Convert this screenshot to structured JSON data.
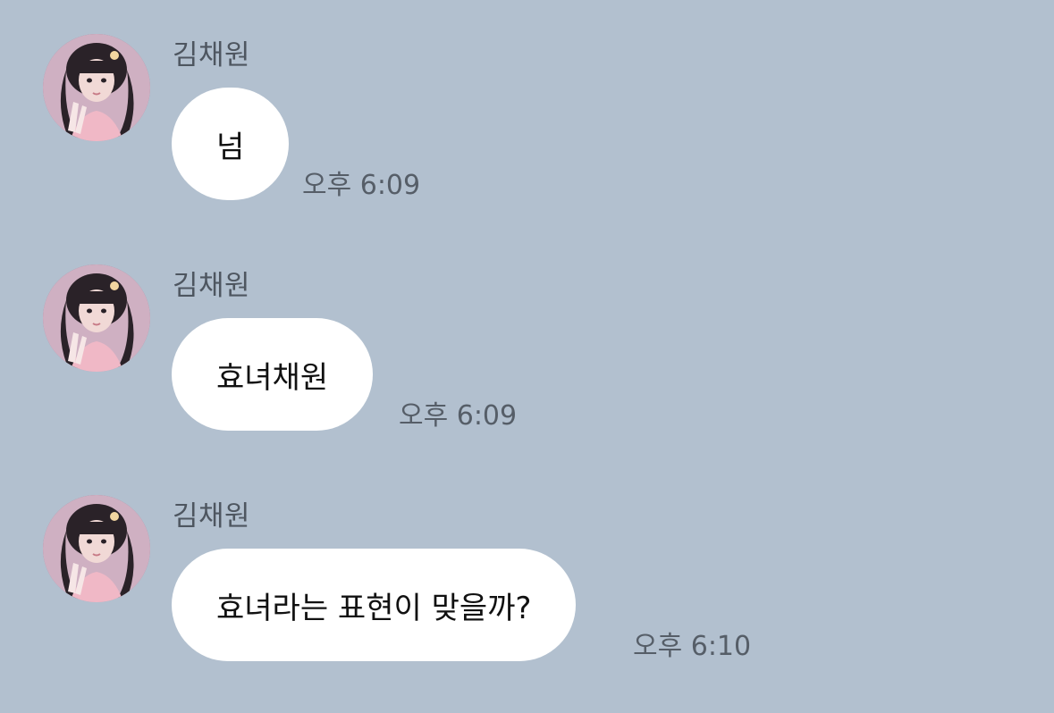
{
  "colors": {
    "background": "#b2c0cf",
    "bubble": "#ffffff",
    "name_text": "#4e5660",
    "time_text": "#565e68"
  },
  "messages": [
    {
      "sender": "김채원",
      "avatar_icon": "profile-photo",
      "text": "넘",
      "time": "오후 6:09"
    },
    {
      "sender": "김채원",
      "avatar_icon": "profile-photo",
      "text": "효녀채원",
      "time": "오후 6:09"
    },
    {
      "sender": "김채원",
      "avatar_icon": "profile-photo",
      "text": "효녀라는 표현이 맞을까?",
      "time": "오후 6:10"
    }
  ]
}
